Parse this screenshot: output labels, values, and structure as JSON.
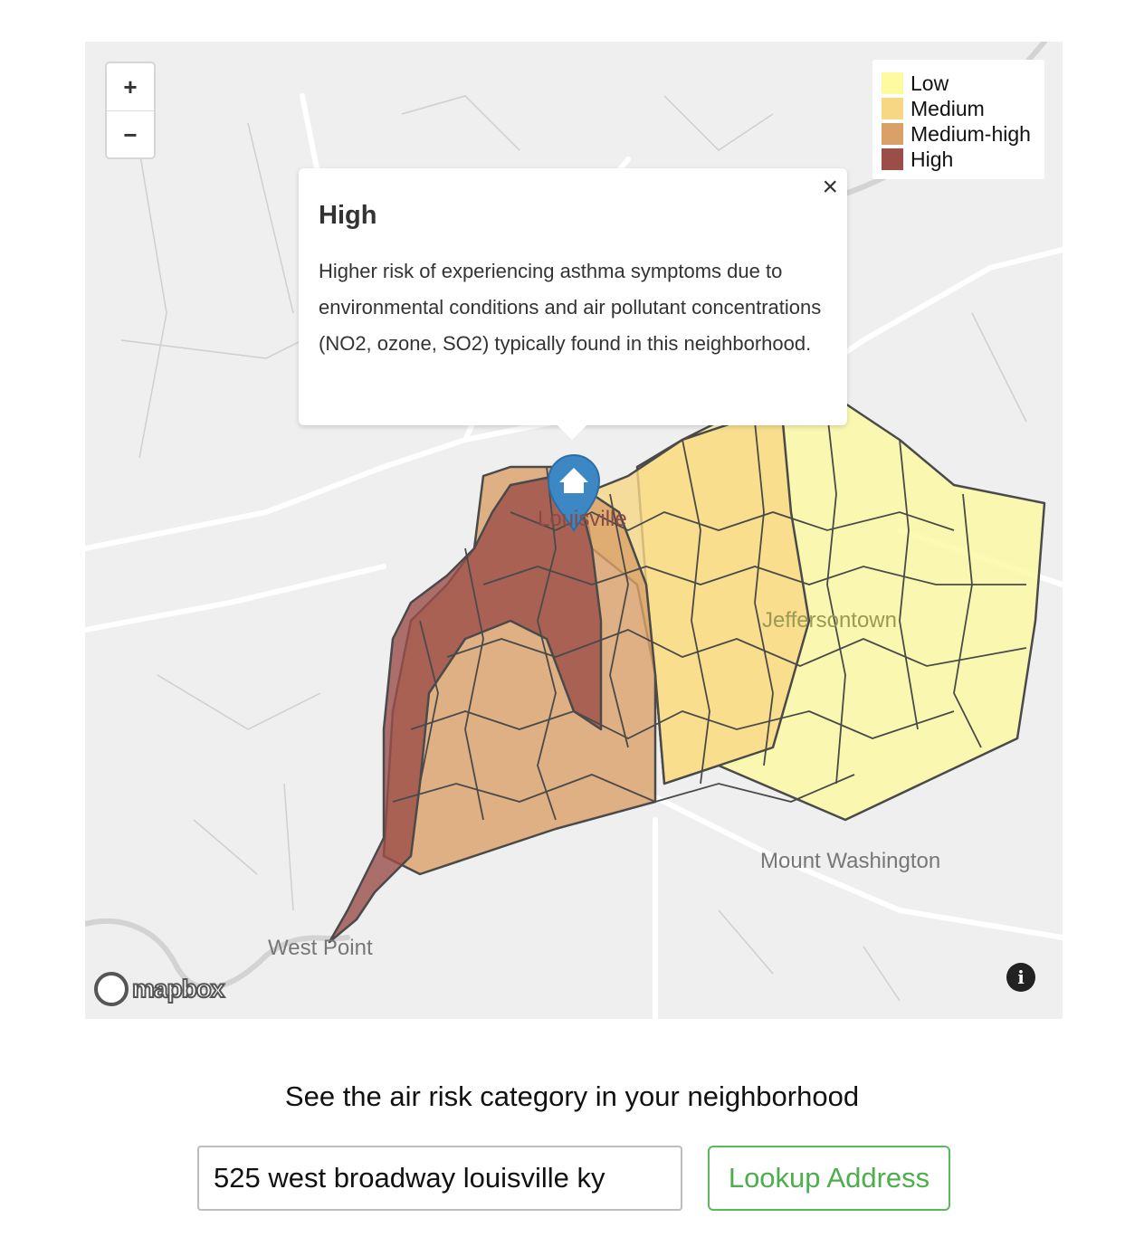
{
  "map": {
    "zoom_in_label": "+",
    "zoom_out_label": "−",
    "legend": [
      {
        "label": "Low",
        "color": "#fdfaa0"
      },
      {
        "label": "Medium",
        "color": "#f8d784"
      },
      {
        "label": "Medium-high",
        "color": "#d9a068"
      },
      {
        "label": "High",
        "color": "#9b4e48"
      }
    ],
    "popup": {
      "title": "High",
      "body": "Higher risk of experiencing asthma symptoms due to environmental conditions and air pollutant concentrations (NO2, ozone, SO2) typically found in this neighborhood.",
      "close_label": "×"
    },
    "places": {
      "louisville": "Louisville",
      "jeffersontown": "Jeffersontown",
      "mount_washington": "Mount Washington",
      "west_point": "West Point"
    },
    "attribution": "mapbox",
    "info_label": "i",
    "marker_icon": "home-icon"
  },
  "search": {
    "heading": "See the air risk category in your neighborhood",
    "address_value": "525 west broadway louisville ky",
    "button_label": "Lookup Address"
  }
}
